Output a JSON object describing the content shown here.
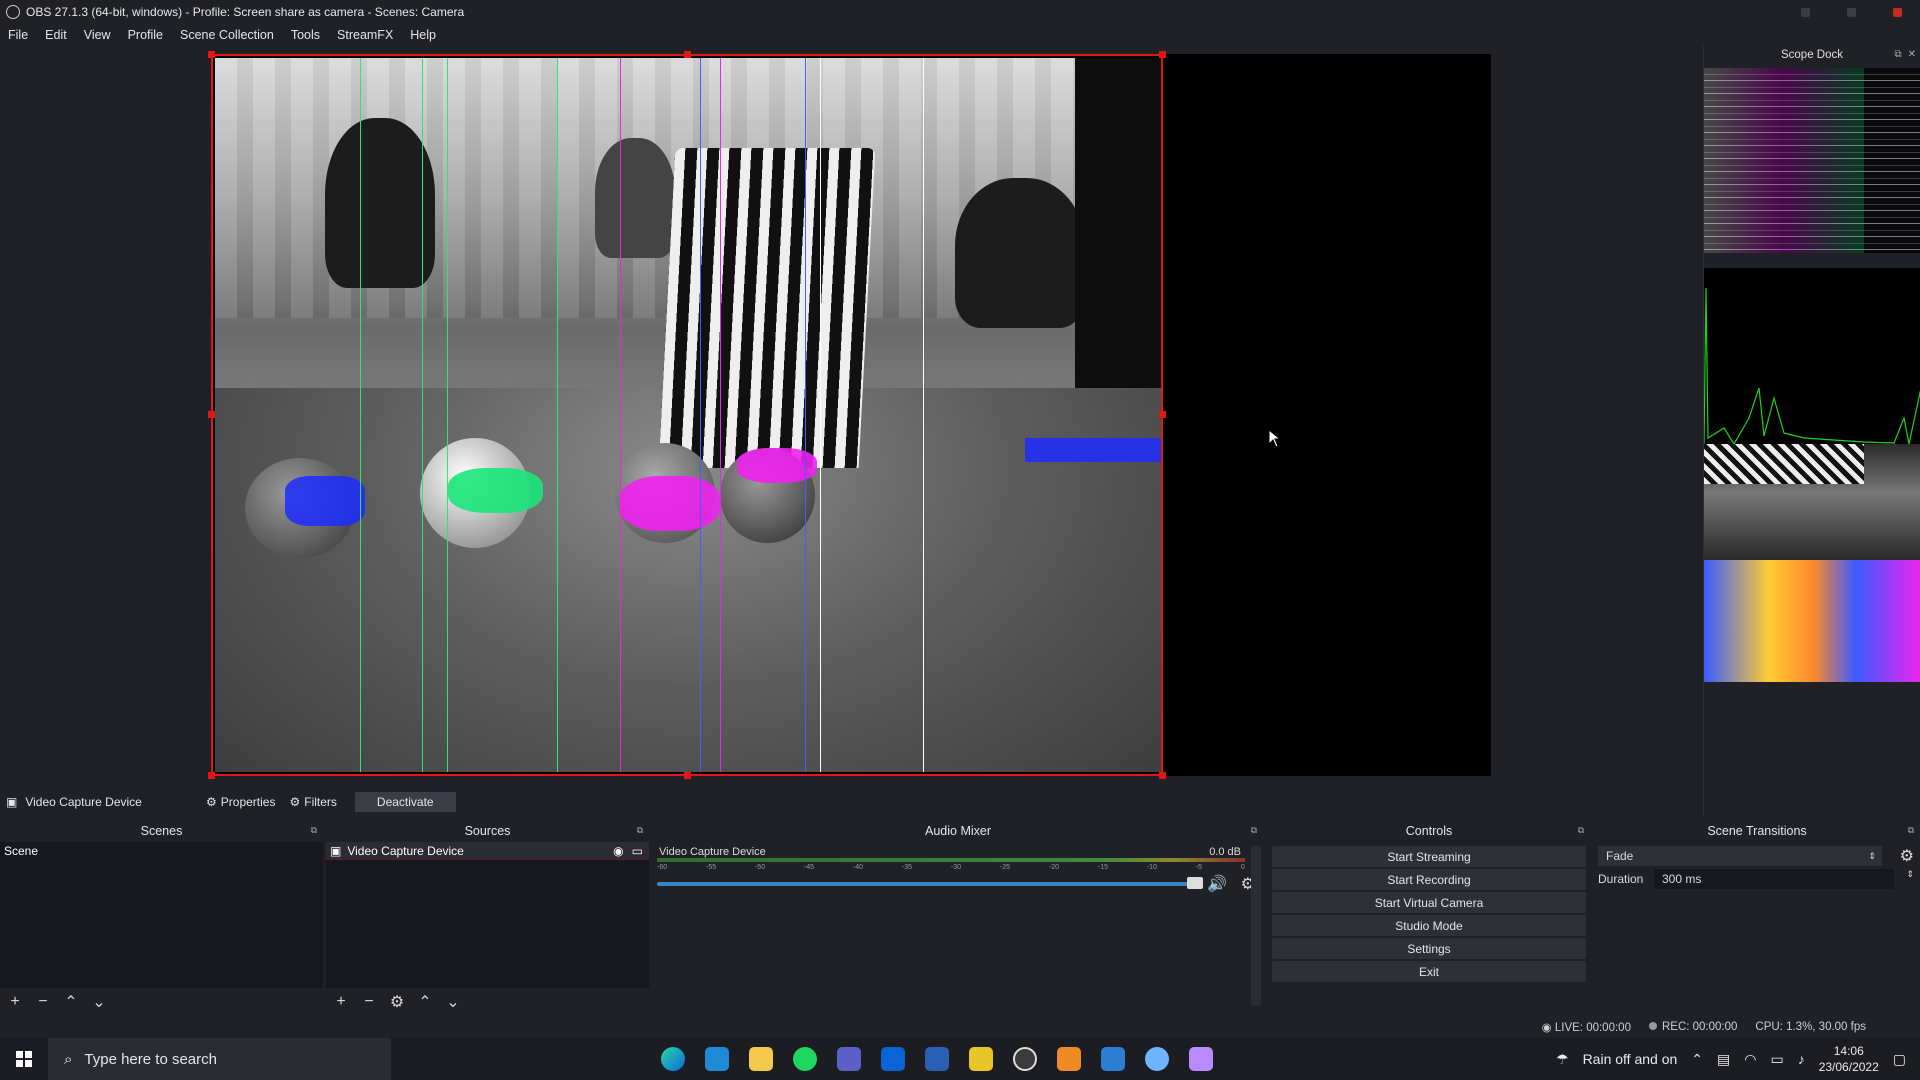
{
  "window": {
    "title": "OBS 27.1.3 (64-bit, windows) - Profile: Screen share as camera - Scenes: Camera"
  },
  "menu": [
    "File",
    "Edit",
    "View",
    "Profile",
    "Scene Collection",
    "Tools",
    "StreamFX",
    "Help"
  ],
  "scope_dock": {
    "title": "Scope Dock"
  },
  "source_toolbar": {
    "source_name": "Video Capture Device",
    "properties": "Properties",
    "filters": "Filters",
    "deactivate": "Deactivate"
  },
  "scenes": {
    "title": "Scenes",
    "items": [
      "Scene"
    ]
  },
  "sources": {
    "title": "Sources",
    "items": [
      "Video Capture Device"
    ]
  },
  "audio_mixer": {
    "title": "Audio Mixer",
    "track_name": "Video Capture Device",
    "level": "0.0 dB",
    "ticks": [
      "-60",
      "-55",
      "-50",
      "-45",
      "-40",
      "-35",
      "-30",
      "-25",
      "-20",
      "-15",
      "-10",
      "-5",
      "0"
    ],
    "volume_fraction": 0.98
  },
  "controls": {
    "title": "Controls",
    "buttons": [
      "Start Streaming",
      "Start Recording",
      "Start Virtual Camera",
      "Studio Mode",
      "Settings",
      "Exit"
    ]
  },
  "scene_transitions": {
    "title": "Scene Transitions",
    "transition": "Fade",
    "duration_label": "Duration",
    "duration_value": "300 ms"
  },
  "status": {
    "live": "LIVE: 00:00:00",
    "rec": "REC: 00:00:00",
    "cpu": "CPU: 1.3%, 30.00 fps"
  },
  "taskbar": {
    "search_placeholder": "Type here to search",
    "weather": "Rain off and on",
    "time": "14:06",
    "date": "23/06/2022"
  },
  "colors": {
    "accent": "#e31616",
    "background": "#1f2127",
    "panel": "#16181d"
  }
}
